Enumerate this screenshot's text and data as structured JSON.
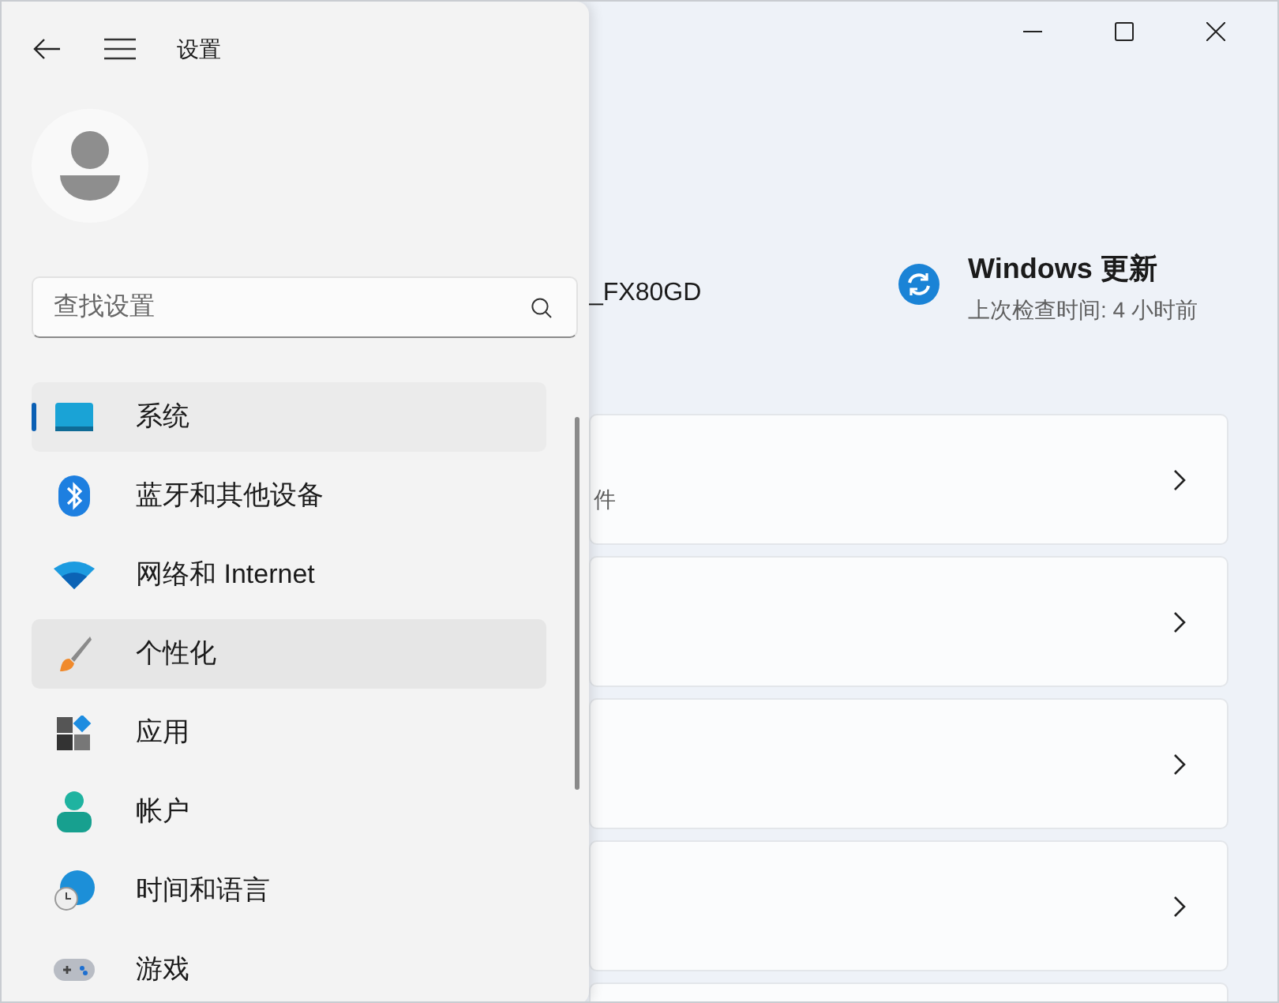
{
  "window": {
    "title": "设置"
  },
  "search": {
    "placeholder": "查找设置"
  },
  "nav_items": [
    {
      "label": "系统",
      "selected": true,
      "hovered": false
    },
    {
      "label": "蓝牙和其他设备",
      "selected": false,
      "hovered": false
    },
    {
      "label": "网络和 Internet",
      "selected": false,
      "hovered": false
    },
    {
      "label": "个性化",
      "selected": false,
      "hovered": true
    },
    {
      "label": "应用",
      "selected": false,
      "hovered": false
    },
    {
      "label": "帐户",
      "selected": false,
      "hovered": false
    },
    {
      "label": "时间和语言",
      "selected": false,
      "hovered": false
    },
    {
      "label": "游戏",
      "selected": false,
      "hovered": false
    }
  ],
  "device_name": "_FX80GD",
  "windows_update": {
    "title": "Windows 更新",
    "subtitle": "上次检查时间: 4 小时前"
  },
  "cards": [
    {
      "kind": "text",
      "text": "件"
    },
    {
      "kind": "blank"
    },
    {
      "kind": "blank"
    },
    {
      "kind": "blank"
    },
    {
      "kind": "blank"
    }
  ]
}
